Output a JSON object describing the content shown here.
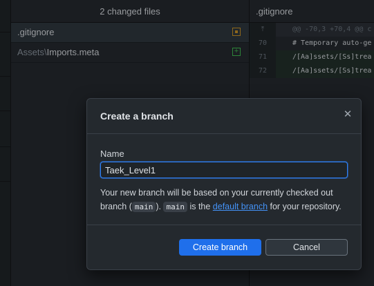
{
  "changes": {
    "header": "2 changed files",
    "files": [
      {
        "dir": "",
        "name": ".gitignore",
        "status": "modified",
        "status_icon": "modified-icon"
      },
      {
        "dir": "Assets\\",
        "name": "Imports.meta",
        "status": "added",
        "status_icon": "added-icon",
        "status_glyph": "+"
      }
    ]
  },
  "diff": {
    "filename": ".gitignore",
    "expand_glyph": "⤒",
    "rows": [
      {
        "type": "hunk",
        "line": "",
        "text": "@@ -70,3 +70,4 @@ c"
      },
      {
        "type": "comment",
        "line": "70",
        "text": "# Temporary auto-ge"
      },
      {
        "type": "add",
        "line": "71",
        "text": "/[Aa]ssets/[Ss]trea"
      },
      {
        "type": "add",
        "line": "72",
        "text": "/[Aa]ssets/[Ss]trea"
      }
    ]
  },
  "dialog": {
    "title": "Create a branch",
    "close_glyph": "✕",
    "name_label": "Name",
    "name_value": "Taek_Level1",
    "help_prefix": "Your new branch will be based on your currently checked out branch (",
    "branch_chip": "main",
    "help_mid": "). ",
    "branch_chip2": "main",
    "help_is": " is the ",
    "link_text": "default branch",
    "help_suffix": " for your repository.",
    "create_label": "Create branch",
    "cancel_label": "Cancel"
  },
  "colors": {
    "accent": "#1f6feb",
    "link": "#4493f8",
    "modified": "#c69026",
    "added": "#3fb950"
  }
}
